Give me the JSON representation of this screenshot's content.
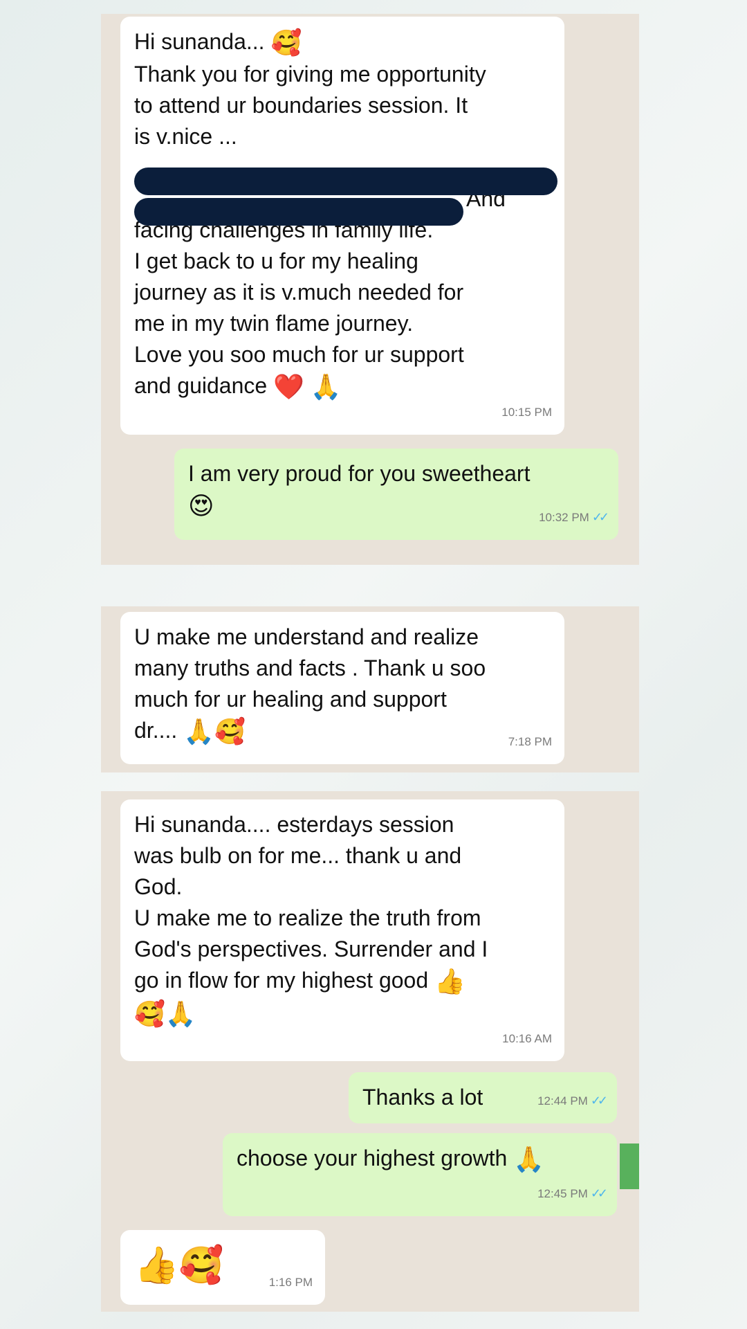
{
  "messages": [
    {
      "lines": [
        "Hi sunanda... ",
        "Thank you for giving me opportunity",
        "to attend ur boundaries session. It",
        "is v.nice ...",
        "And",
        "facing challenges in family life.",
        "I get back to u for my healing",
        "journey as it is v.much needed for",
        "me in my twin flame journey.",
        "Love you soo much for ur support",
        "and guidance "
      ],
      "emojis": [
        "🥰",
        "❤️",
        "🙏"
      ],
      "time": "10:15 PM"
    },
    {
      "lines": [
        "I am very proud for you sweetheart"
      ],
      "emojis": [
        "😍"
      ],
      "time": "10:32 PM",
      "ticks": "✓✓"
    },
    {
      "lines": [
        "U make me understand and realize",
        "many truths and facts . Thank u soo",
        "much for ur healing and support",
        "dr.... "
      ],
      "emojis": [
        "🙏",
        "🥰"
      ],
      "time": "7:18 PM"
    },
    {
      "lines": [
        "Hi sunanda.... esterdays session",
        "was bulb on for me... thank u and",
        "God.",
        "U make me to realize the truth from",
        "God's perspectives.  Surrender and I",
        "go in flow for my  highest good "
      ],
      "emojis": [
        "👍",
        "🥰",
        "🙏"
      ],
      "time": "10:16 AM"
    },
    {
      "lines": [
        "Thanks a lot"
      ],
      "time": "12:44 PM",
      "ticks": "✓✓"
    },
    {
      "lines": [
        "choose your highest growth "
      ],
      "emojis": [
        "🙏"
      ],
      "time": "12:45 PM",
      "ticks": "✓✓"
    },
    {
      "emojis": [
        "👍",
        "🥰"
      ],
      "time": "1:16 PM"
    }
  ],
  "colors": {
    "incoming_bubble": "#ffffff",
    "outgoing_bubble": "#dcf8c6",
    "chat_background": "#e9e2d9",
    "read_ticks": "#4fb6ec",
    "redaction": "#0b1e3b"
  }
}
